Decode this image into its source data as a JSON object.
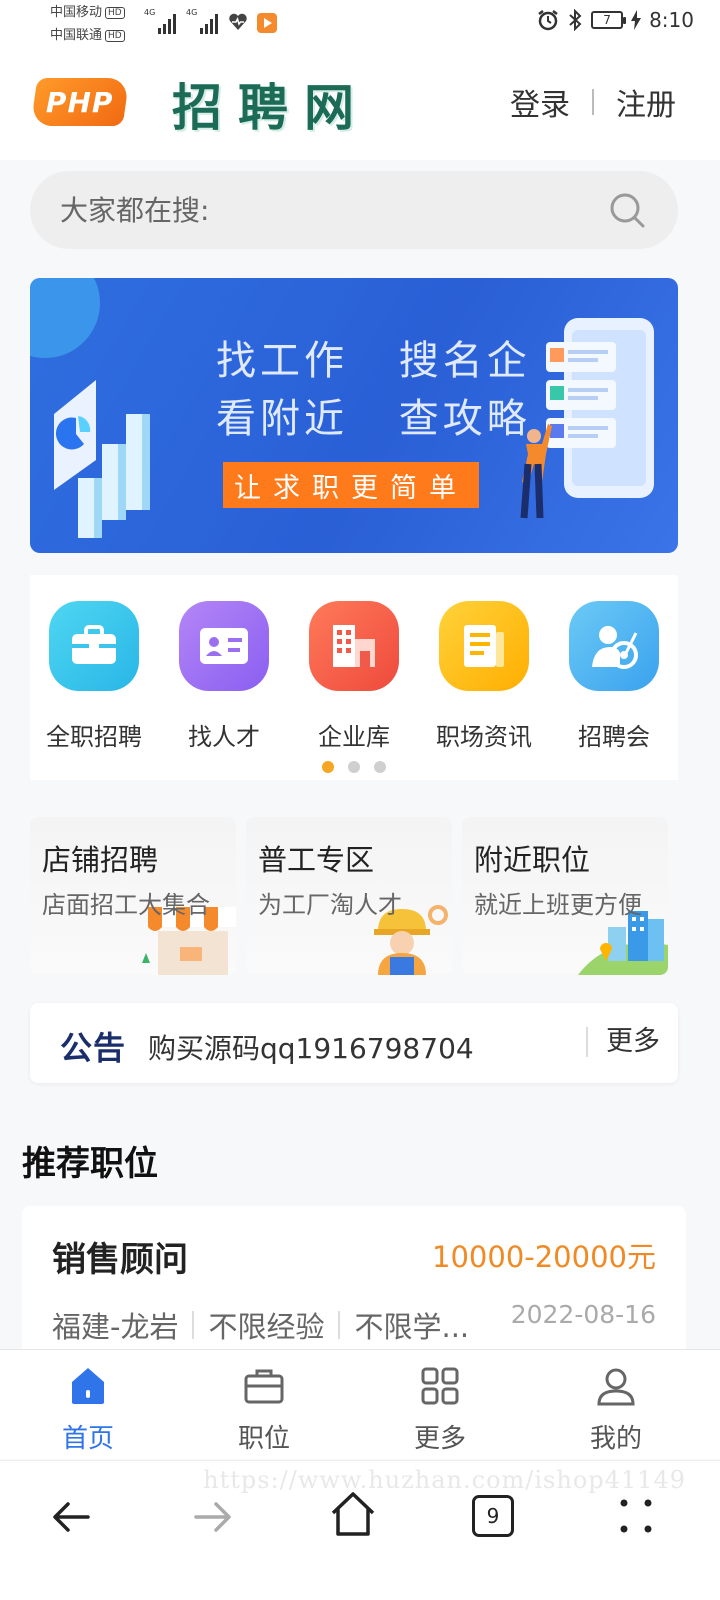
{
  "status_bar": {
    "carrier1": "中国移动",
    "carrier2": "中国联通",
    "hd": "HD",
    "network": "4G",
    "battery": "7",
    "time": "8:10"
  },
  "header": {
    "logo_text": "PHP",
    "site_name": "招聘网",
    "login": "登录",
    "register": "注册"
  },
  "search": {
    "placeholder": "大家都在搜:"
  },
  "banner": {
    "line1": "找工作 搜名企",
    "line2": "看附近 查攻略",
    "cta": "让求职更简单"
  },
  "categories": [
    {
      "label": "全职招聘",
      "icon": "briefcase-icon",
      "color": "#3fc8ec"
    },
    {
      "label": "找人才",
      "icon": "id-card-icon",
      "color": "#9a6ff0"
    },
    {
      "label": "企业库",
      "icon": "building-icon",
      "color": "#f05a4a"
    },
    {
      "label": "职场资讯",
      "icon": "news-icon",
      "color": "#ffb400"
    },
    {
      "label": "招聘会",
      "icon": "person-target-icon",
      "color": "#49b4f0"
    }
  ],
  "carousel": {
    "pages": 3,
    "current": 1
  },
  "features": [
    {
      "title": "店铺招聘",
      "subtitle": "店面招工大集合"
    },
    {
      "title": "普工专区",
      "subtitle": "为工厂淘人才"
    },
    {
      "title": "附近职位",
      "subtitle": "就近上班更方便"
    }
  ],
  "notice": {
    "tag": "公告",
    "message": "购买源码qq1916798704",
    "more": "更多"
  },
  "recommend": {
    "title": "推荐职位",
    "jobs": [
      {
        "name": "销售顾问",
        "salary": "10000-20000元",
        "location": "福建-龙岩",
        "experience": "不限经验",
        "education": "不限学...",
        "date": "2022-08-16"
      }
    ]
  },
  "tabbar": [
    {
      "label": "首页",
      "icon": "home-icon",
      "active": true
    },
    {
      "label": "职位",
      "icon": "briefcase-icon",
      "active": false
    },
    {
      "label": "更多",
      "icon": "grid-icon",
      "active": false
    },
    {
      "label": "我的",
      "icon": "user-icon",
      "active": false
    }
  ],
  "watermark": "https://www.huzhan.com/ishop41149",
  "browser_nav": {
    "tab_count": "9"
  },
  "colors": {
    "accent_blue": "#2f74e8",
    "salary_orange": "#f08a24",
    "cta_orange": "#ff7a1a",
    "brand_green": "#1b6b57"
  }
}
